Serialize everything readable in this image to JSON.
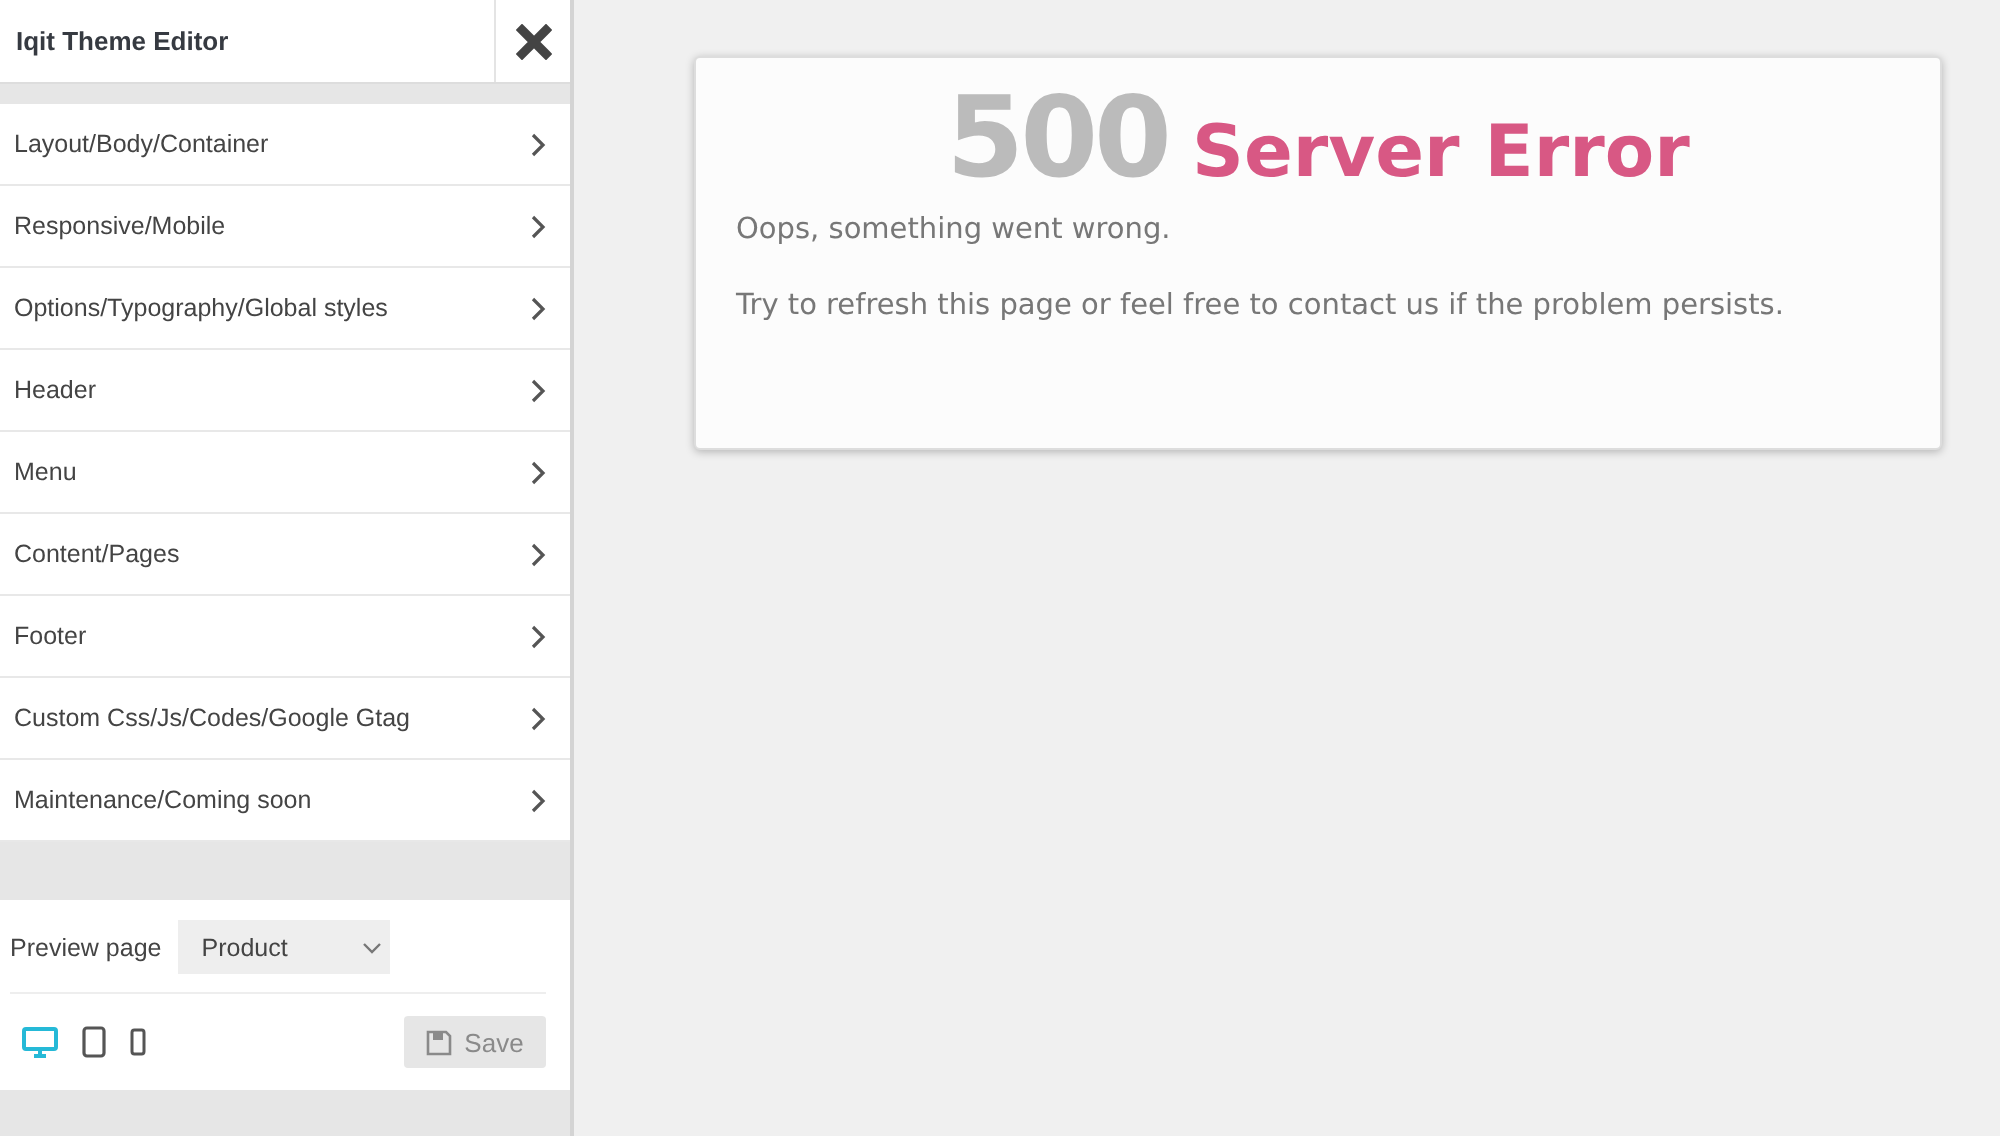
{
  "sidebar": {
    "title": "Iqit Theme Editor",
    "items": [
      {
        "label": "Layout/Body/Container"
      },
      {
        "label": "Responsive/Mobile"
      },
      {
        "label": "Options/Typography/Global styles"
      },
      {
        "label": "Header"
      },
      {
        "label": "Menu"
      },
      {
        "label": "Content/Pages"
      },
      {
        "label": "Footer"
      },
      {
        "label": "Custom Css/Js/Codes/Google Gtag"
      },
      {
        "label": "Maintenance/Coming soon"
      }
    ],
    "preview": {
      "label": "Preview page",
      "value": "Product"
    },
    "devices": [
      {
        "kind": "desktop",
        "selected": true
      },
      {
        "kind": "tablet",
        "selected": false
      },
      {
        "kind": "phone",
        "selected": false
      }
    ],
    "save": {
      "label": "Save",
      "disabled": true
    }
  },
  "error": {
    "code": "500",
    "title": "Server Error",
    "message": "Oops, something went wrong.",
    "hint": "Try to refresh this page or feel free to contact us if the problem persists."
  }
}
